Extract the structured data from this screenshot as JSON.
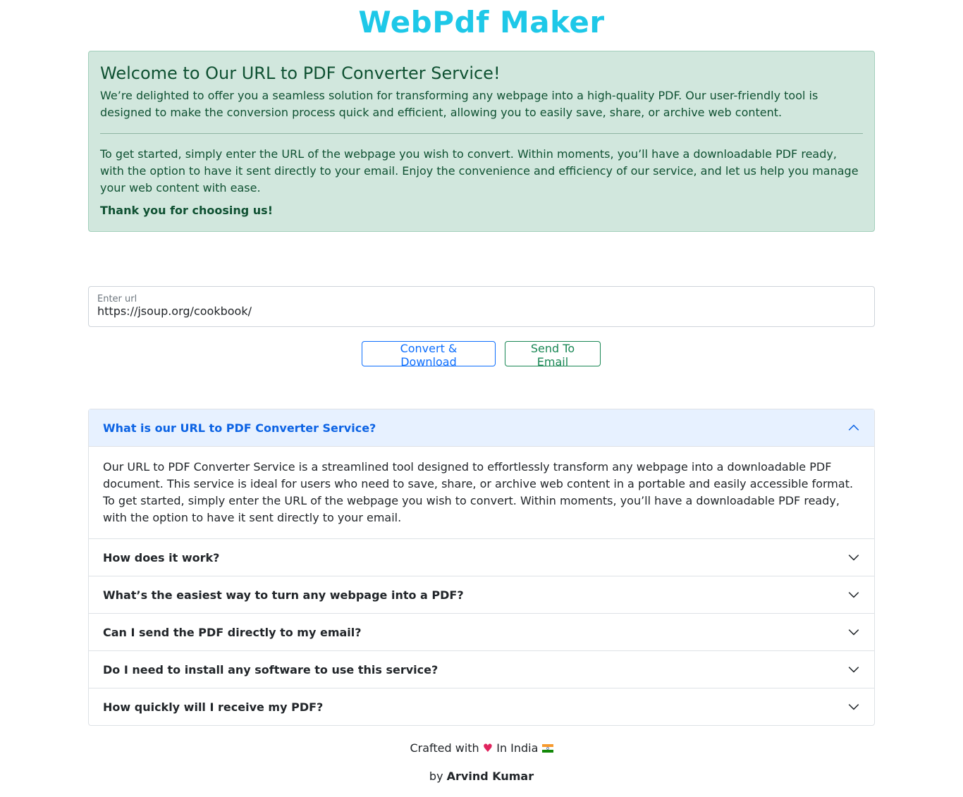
{
  "header": {
    "title": "WebPdf Maker"
  },
  "welcome": {
    "heading": "Welcome to Our URL to PDF Converter Service!",
    "intro": "We’re delighted to offer you a seamless solution for transforming any webpage into a high-quality PDF. Our user-friendly tool is designed to make the conversion process quick and efficient, allowing you to easily save, share, or archive web content.",
    "instructions": "To get started, simply enter the URL of the webpage you wish to convert. Within moments, you’ll have a downloadable PDF ready, with the option to have it sent directly to your email. Enjoy the convenience and efficiency of our service, and let us help you manage your web content with ease.",
    "thanks": "Thank you for choosing us!"
  },
  "form": {
    "url_label": "Enter url",
    "url_value": "https://jsoup.org/cookbook/",
    "convert_label": "Convert & Download",
    "email_label": "Send To Email"
  },
  "faq": [
    {
      "question": "What is our URL to PDF Converter Service?",
      "answer": "Our URL to PDF Converter Service is a streamlined tool designed to effortlessly transform any webpage into a downloadable PDF document. This service is ideal for users who need to save, share, or archive web content in a portable and easily accessible format. To get started, simply enter the URL of the webpage you wish to convert. Within moments, you’ll have a downloadable PDF ready, with the option to have it sent directly to your email.",
      "expanded": true
    },
    {
      "question": "How does it work?",
      "expanded": false
    },
    {
      "question": "What’s the easiest way to turn any webpage into a PDF?",
      "expanded": false
    },
    {
      "question": "Can I send the PDF directly to my email?",
      "expanded": false
    },
    {
      "question": "Do I need to install any software to use this service?",
      "expanded": false
    },
    {
      "question": "How quickly will I receive my PDF?",
      "expanded": false
    }
  ],
  "footer": {
    "crafted_prefix": "Crafted with",
    "heart_glyph": "♥",
    "crafted_suffix": "In India",
    "by_prefix": "by",
    "author": "Arvind Kumar"
  },
  "colors": {
    "title": "#1ec8e8",
    "alert_bg": "#d1e7dd",
    "alert_text": "#0f5132",
    "primary": "#0d6efd",
    "success": "#198754",
    "accordion_active_bg": "#e7f1ff"
  }
}
